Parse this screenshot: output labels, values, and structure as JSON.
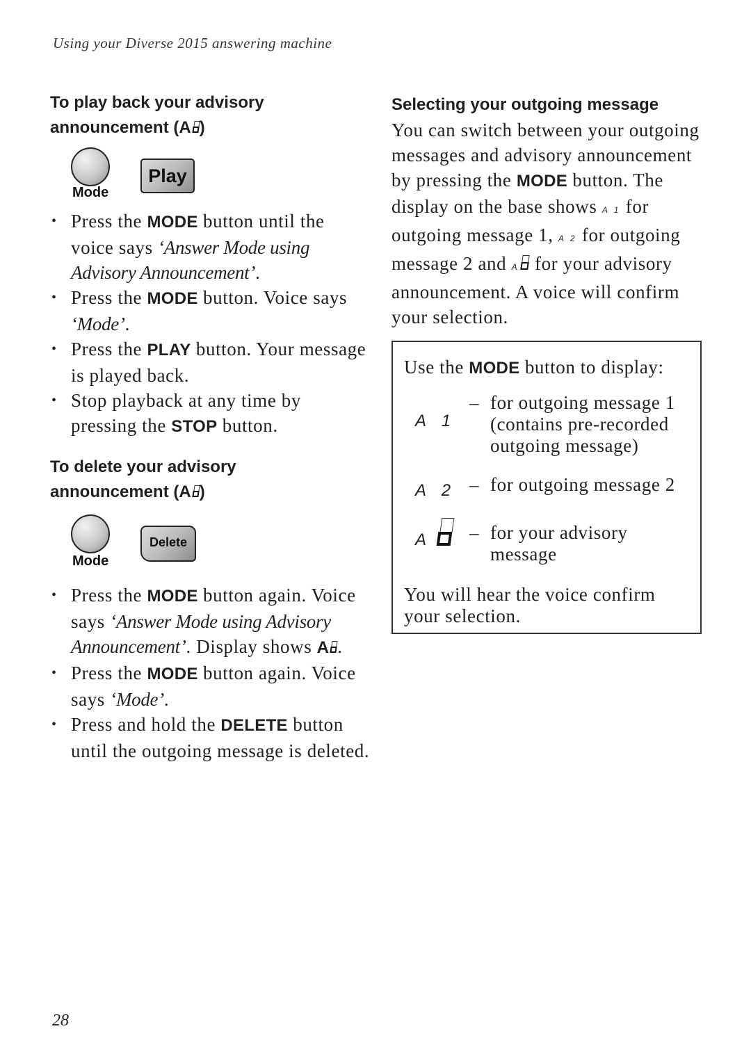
{
  "header": {
    "running_title": "Using your Diverse 2015 answering machine"
  },
  "left_column": {
    "playback_section": {
      "heading_line1": "To play back your advisory",
      "heading_line2": "announcement (A",
      "heading_close": ")",
      "buttons": {
        "mode_label": "Mode",
        "play_label": "Play"
      },
      "steps": [
        {
          "pre": "Press the ",
          "kw": "MODE",
          "mid": " button until the voice says ",
          "quote": "‘Answer Mode using Advisory Announcement’",
          "post": "."
        },
        {
          "pre": "Press the ",
          "kw": "MODE",
          "mid": " button. Voice says ",
          "quote": "‘Mode’",
          "post": "."
        },
        {
          "pre": "Press the ",
          "kw": "PLAY",
          "mid": " button. Your message is played back.",
          "quote": "",
          "post": ""
        },
        {
          "pre": "Stop playback at any time by pressing the ",
          "kw": "STOP",
          "mid": " button.",
          "quote": "",
          "post": ""
        }
      ]
    },
    "delete_section": {
      "heading_line1": "To delete your advisory",
      "heading_line2": "announcement (A",
      "heading_close": ")",
      "buttons": {
        "mode_label": "Mode",
        "delete_label": "Delete"
      },
      "steps": [
        {
          "pre": "Press the ",
          "kw": "MODE",
          "mid": " button again. Voice says ",
          "quote": "‘Answer Mode using Advisory Announcement’",
          "post": ". Display shows ",
          "kw2": "A",
          "post2": "."
        },
        {
          "pre": "Press the ",
          "kw": "MODE",
          "mid": " button again. Voice says ",
          "quote": "‘Mode’",
          "post": "."
        },
        {
          "pre": "Press and hold the ",
          "kw": "DELETE",
          "mid": " button until the outgoing message is deleted.",
          "quote": "",
          "post": ""
        }
      ]
    }
  },
  "right_column": {
    "heading": "Selecting your outgoing message",
    "para": {
      "p1": "You can switch between your outgoing messages and advisory announcement by pressing the ",
      "kw": "MODE",
      "p2": " button. The display on the base shows ",
      "code1": "A 1",
      "p3": " for outgoing message 1, ",
      "code2": "A 2",
      "p4": " for outgoing message 2 and ",
      "code3": "A",
      "p5": " for your advisory announcement. A voice will confirm your selection."
    },
    "box": {
      "intro_pre": "Use the ",
      "intro_kw": "MODE",
      "intro_post": " button to display:",
      "rows": [
        {
          "code": "A 1",
          "dash": "–",
          "desc": "for outgoing message 1 (contains pre-recorded outgoing message)"
        },
        {
          "code": "A 2",
          "dash": "–",
          "desc": "for outgoing message 2"
        },
        {
          "code": "A",
          "dash": "–",
          "desc": "for your advisory message"
        }
      ],
      "footer": "You will hear the voice confirm your selection."
    }
  },
  "footer": {
    "page_number": "28"
  }
}
